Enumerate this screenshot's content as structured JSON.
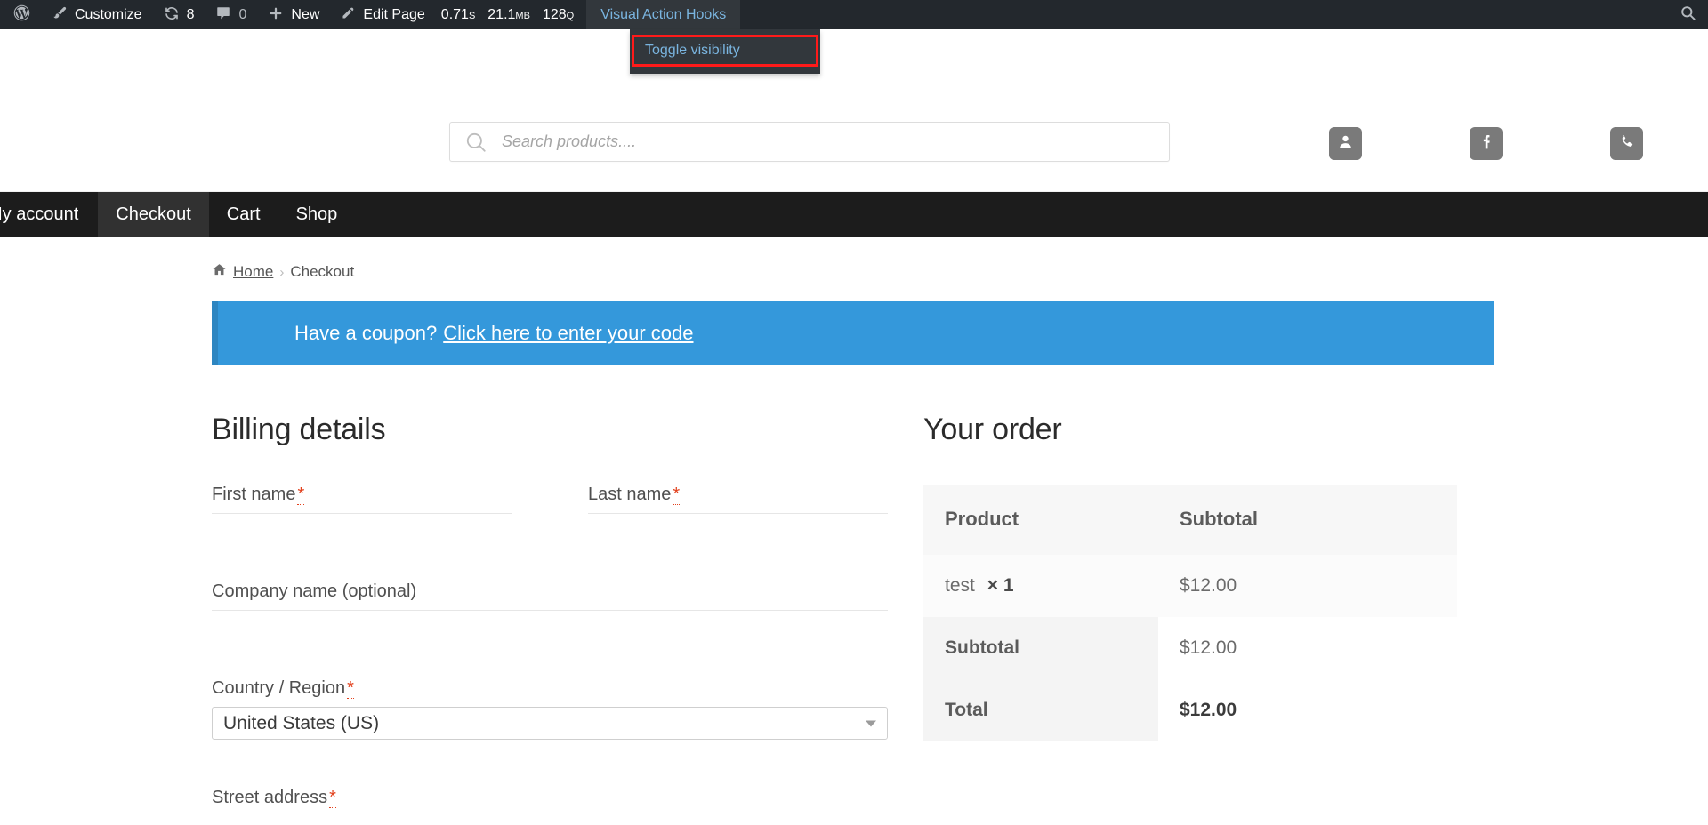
{
  "adminbar": {
    "wp_logo": "wordpress-logo",
    "customize": "Customize",
    "updates_count": "8",
    "comments_count": "0",
    "new": "New",
    "edit_page": "Edit Page",
    "perf_time": "0.71",
    "perf_time_unit": "S",
    "perf_mem": "21.1",
    "perf_mem_unit": "MB",
    "perf_queries": "128",
    "perf_queries_unit": "Q",
    "visual_action_hooks": "Visual Action Hooks",
    "dropdown": {
      "items": [
        {
          "label": "Toggle visibility",
          "highlighted": true
        }
      ],
      "highlight_color": "#ff1a1a"
    },
    "search_icon": "search-icon",
    "bg_color": "#23282d",
    "link_color": "#7ab5e0"
  },
  "header": {
    "search": {
      "placeholder": "Search products....",
      "value": ""
    },
    "icons": [
      {
        "name": "account-icon",
        "glyph": "user"
      },
      {
        "name": "facebook-icon",
        "glyph": "facebook"
      },
      {
        "name": "phone-icon",
        "glyph": "phone"
      }
    ]
  },
  "nav": {
    "items": [
      {
        "label": "My account",
        "active": false
      },
      {
        "label": "Checkout",
        "active": true
      },
      {
        "label": "Cart",
        "active": false
      },
      {
        "label": "Shop",
        "active": false
      }
    ]
  },
  "breadcrumb": {
    "home": "Home",
    "separator": "›",
    "current": "Checkout"
  },
  "coupon": {
    "text": "Have a coupon?",
    "link": "Click here to enter your code",
    "bg_color": "#3498db"
  },
  "billing": {
    "title": "Billing details",
    "fields": {
      "first_name": {
        "label": "First name",
        "required": true,
        "value": ""
      },
      "last_name": {
        "label": "Last name",
        "required": true,
        "value": ""
      },
      "company": {
        "label": "Company name (optional)",
        "required": false,
        "value": ""
      },
      "country": {
        "label": "Country / Region",
        "required": true,
        "value": "United States (US)"
      },
      "street": {
        "label": "Street address",
        "required": true,
        "value": ""
      }
    },
    "required_mark": "*"
  },
  "order": {
    "title": "Your order",
    "columns": [
      "Product",
      "Subtotal"
    ],
    "items": [
      {
        "name": "test",
        "qty_sep": "×",
        "qty": "1",
        "subtotal": "$12.00"
      }
    ],
    "totals": [
      {
        "label": "Subtotal",
        "value": "$12.00",
        "emphasis": false
      },
      {
        "label": "Total",
        "value": "$12.00",
        "emphasis": true
      }
    ]
  }
}
